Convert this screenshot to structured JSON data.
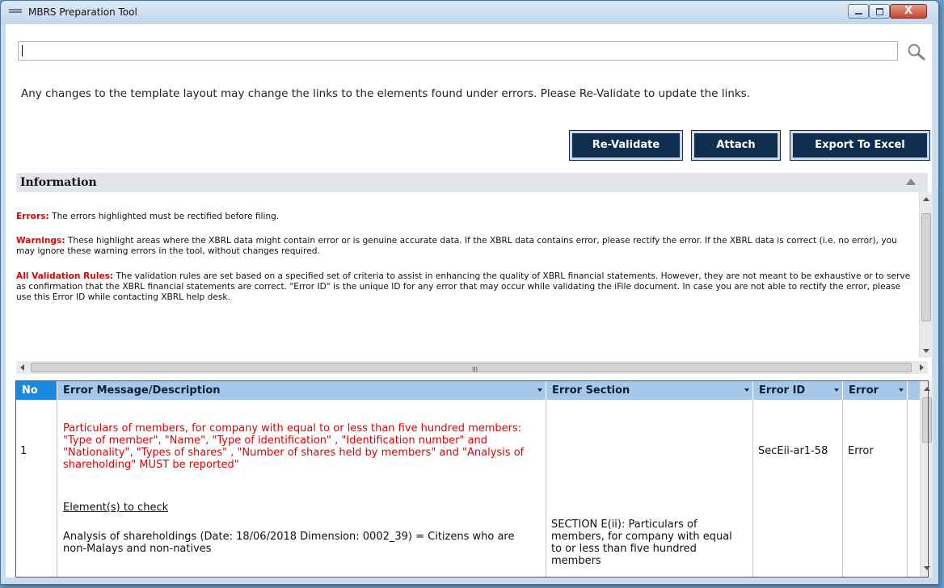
{
  "window": {
    "title": "MBRS Preparation Tool",
    "close_symbol": "X"
  },
  "search": {
    "value": "",
    "icon": "search-icon"
  },
  "notice": "Any changes to the template layout may change the links to the elements found under errors. Please Re-Validate to update the links.",
  "buttons": {
    "revalidate": "Re-Validate",
    "attach": "Attach",
    "export": "Export To Excel"
  },
  "info": {
    "title": "Information",
    "errors_label": "Errors:",
    "errors_text": " The errors highlighted must be rectified before filing.",
    "warnings_label": "Warnings:",
    "warnings_text": " These highlight areas where the XBRL data might contain error or is genuine accurate data. If the XBRL data contains error, please rectify the error. If the XBRL data is correct (i.e. no error), you may ignore these warning errors in the tool, without changes required.",
    "rules_label": "All Validation Rules:",
    "rules_text": " The validation rules are set based on a specified set of criteria to assist in enhancing the quality of XBRL financial statements. However, they are not meant to be exhaustive or to serve as confirmation that the XBRL financial statements are correct. \"Error ID\" is the unique ID for any error that may occur while validating the iFile document. In case you are not able to rectify the error, please use this Error ID while contacting XBRL help desk.",
    "hscroll_grip": "III"
  },
  "table": {
    "headers": {
      "no": "No",
      "message": "Error Message/Description",
      "section": "Error Section",
      "error_id": "Error ID",
      "error": "Error"
    },
    "rows": [
      {
        "no": "1",
        "message_red": "Particulars of members, for company with  equal to or less than five hundred members: \"Type of member\", \"Name\", \"Type of identification\" , \"Identification number\" and \"Nationality\", \"Types of shares\" , \"Number of shares held by members\" and \"Analysis of shareholding\" MUST be reported\"",
        "elements_heading": "Element(s) to check",
        "element": "Analysis of shareholdings (Date: 18/06/2018 Dimension: 0002_39) = Citizens who are non-Malays and non-natives",
        "section": "SECTION E(ii): Particulars of members, for company with equal to or less than five hundred members",
        "error_id": "SecEii-ar1-58",
        "error": "Error"
      }
    ]
  },
  "colors": {
    "button_bg": "#0e2d4f",
    "header_blue": "#a6c8ea",
    "no_header": "#1a8ae0",
    "error_red": "#e00000"
  }
}
